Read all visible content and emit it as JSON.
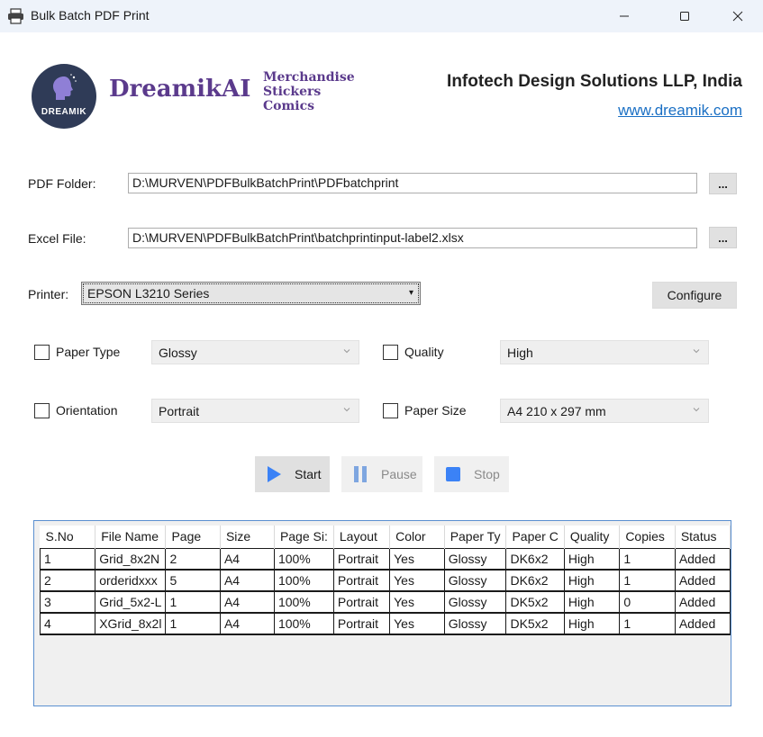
{
  "window": {
    "title": "Bulk Batch PDF Print",
    "icon": "printer-icon"
  },
  "header": {
    "logo_text": "DREAMIK",
    "brand": "DreamikAI",
    "tagline": [
      "Merchandise",
      "Stickers",
      "Comics"
    ],
    "company": "Infotech Design Solutions LLP, India",
    "website": "www.dreamik.com",
    "brand_color": "#5b3a8c",
    "link_color": "#1a6fc4"
  },
  "form": {
    "pdf_folder_label": "PDF Folder:",
    "pdf_folder_value": "D:\\MURVEN\\PDFBulkBatchPrint\\PDFbatchprint",
    "excel_file_label": "Excel File:",
    "excel_file_value": "D:\\MURVEN\\PDFBulkBatchPrint\\batchprintinput-label2.xlsx",
    "browse_label": "...",
    "printer_label": "Printer:",
    "printer_value": "EPSON L3210 Series",
    "configure_label": "Configure"
  },
  "options": {
    "paper_type": {
      "label": "Paper Type",
      "checked": false,
      "value": "Glossy"
    },
    "quality": {
      "label": "Quality",
      "checked": false,
      "value": "High"
    },
    "orientation": {
      "label": "Orientation",
      "checked": false,
      "value": "Portrait"
    },
    "paper_size": {
      "label": "Paper Size",
      "checked": false,
      "value": "A4 210 x 297 mm"
    }
  },
  "actions": {
    "start_label": "Start",
    "pause_label": "Pause",
    "stop_label": "Stop",
    "accent_color": "#3b82f6"
  },
  "grid": {
    "columns": [
      "S.No",
      "File Name",
      "Page",
      "Size",
      "Page Si:",
      "Layout",
      "Color",
      "Paper Ty",
      "Paper C",
      "Quality",
      "Copies",
      "Status"
    ],
    "rows": [
      [
        "1",
        "Grid_8x2N",
        "2",
        "A4",
        "100%",
        "Portrait",
        "Yes",
        "Glossy",
        "DK6x2",
        "High",
        "1",
        "Added"
      ],
      [
        "2",
        "orderidxxx",
        "5",
        "A4",
        "100%",
        "Portrait",
        "Yes",
        "Glossy",
        "DK6x2",
        "High",
        "1",
        "Added"
      ],
      [
        "3",
        "Grid_5x2-L",
        "1",
        "A4",
        "100%",
        "Portrait",
        "Yes",
        "Glossy",
        "DK5x2",
        "High",
        "0",
        "Added"
      ],
      [
        "4",
        "XGrid_8x2l",
        "1",
        "A4",
        "100%",
        "Portrait",
        "Yes",
        "Glossy",
        "DK5x2",
        "High",
        "1",
        "Added"
      ]
    ]
  }
}
